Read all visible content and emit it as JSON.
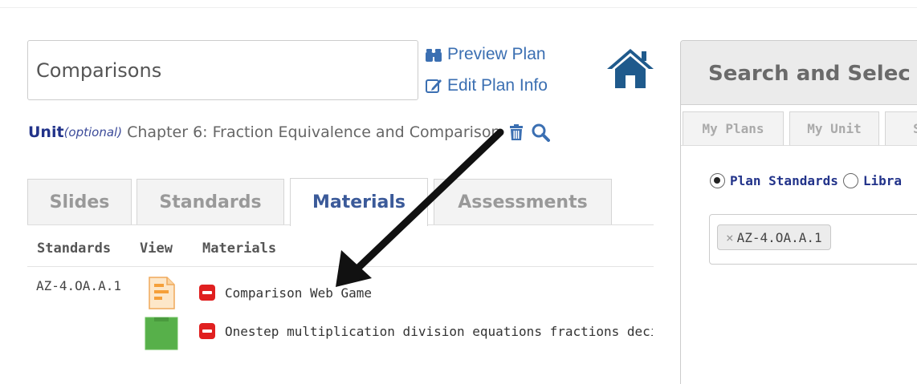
{
  "plan": {
    "title_value": "Comparisons",
    "preview_label": "Preview Plan",
    "edit_label": "Edit Plan Info"
  },
  "unit": {
    "label": "Unit",
    "optional": "(optional)",
    "value": "Chapter 6: Fraction Equivalence and Comparison"
  },
  "tabs": [
    {
      "label": "Slides",
      "active": false
    },
    {
      "label": "Standards",
      "active": false
    },
    {
      "label": "Materials",
      "active": true
    },
    {
      "label": "Assessments",
      "active": false
    }
  ],
  "materials": {
    "headers": [
      "Standards",
      "View",
      "Materials"
    ],
    "rows": [
      {
        "standard": "AZ-4.OA.A.1",
        "view_icon": "document-icon",
        "name": "Comparison Web Game"
      },
      {
        "standard": "",
        "view_icon": "green-file-icon",
        "name": "Onestep multiplication division equations fractions decimals"
      }
    ]
  },
  "panel": {
    "title": "Search and Selec",
    "tabs": [
      "My Plans",
      "My Unit",
      "S"
    ],
    "radio_options": [
      {
        "label": "Plan Standards",
        "checked": true
      },
      {
        "label": "Libra",
        "checked": false
      }
    ],
    "selected_standard": "AZ-4.OA.A.1",
    "chip_remove": "×"
  },
  "colors": {
    "link_blue": "#3b6fb2",
    "home_blue": "#1f5a8c",
    "unit_navy": "#22338a",
    "remove_red": "#e02020",
    "green_file": "#57b04a"
  }
}
